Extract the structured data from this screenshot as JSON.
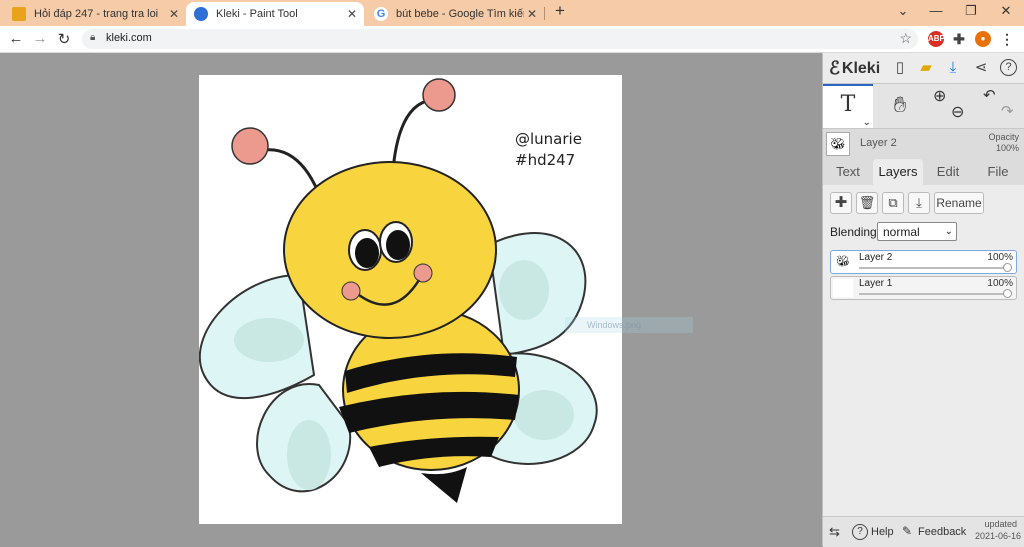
{
  "browser": {
    "tabs": [
      {
        "title": "Hỏi đáp 247 - trang tra loi",
        "favicon_color": "#e8a21c",
        "active": false
      },
      {
        "title": "Kleki - Paint Tool",
        "favicon_color": "#2d6fd6",
        "active": true
      },
      {
        "title": "bút bebe - Google Tìm kiếm",
        "favicon_color": "#4285f4",
        "active": false
      }
    ],
    "new_tab": "+",
    "url": "kleki.com",
    "extensions": {
      "abp": "ABP"
    },
    "tab_bar_color": "#f6cba8"
  },
  "canvas": {
    "annotation_line1": "@lunarie",
    "annotation_line2": "#hd247",
    "watermark": "Windows.png"
  },
  "kleki": {
    "logo": "Kleki",
    "current_layer": "Layer 2",
    "opacity_label": "Opacity",
    "opacity_value": "100%",
    "tabs": [
      "Text",
      "Layers",
      "Edit",
      "File"
    ],
    "active_tab": "Layers",
    "rename_label": "Rename",
    "blending_label": "Blending",
    "blending_value": "normal",
    "layers": [
      {
        "name": "Layer 2",
        "opacity": "100%",
        "selected": true
      },
      {
        "name": "Layer 1",
        "opacity": "100%",
        "selected": false
      }
    ],
    "help_label": "Help",
    "feedback_label": "Feedback",
    "updated_label": "updated",
    "updated_date": "2021-06-16",
    "accent_color": "#2a66c2"
  }
}
